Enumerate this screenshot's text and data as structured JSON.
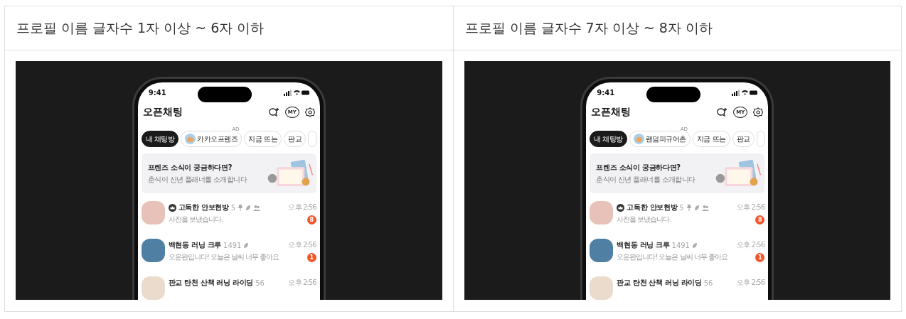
{
  "columns": [
    {
      "heading": "프로필 이름 글자수 1자 이상 ~ 6자 이하",
      "phone": {
        "status_time": "9:41",
        "app_title": "오픈채팅",
        "my_icon_label": "MY",
        "chips": [
          {
            "label": "내 채팅방",
            "selected": true,
            "kind": "plain"
          },
          {
            "label": "카카오프렌즈",
            "selected": false,
            "kind": "ad",
            "ad_label": "AD"
          },
          {
            "label": "지금 뜨는",
            "selected": false,
            "kind": "plain"
          },
          {
            "label": "판교",
            "selected": false,
            "kind": "plain"
          }
        ],
        "banner": {
          "title": "프렌즈 소식이 궁금하다면?",
          "subtitle": "춘식이 신년 플래너를 소개합니다"
        },
        "chats": [
          {
            "name": "고독한 안보현방",
            "host": true,
            "member_count": "5",
            "pin_icon": true,
            "leaf_icon": true,
            "people_icon": true,
            "preview": "사진을 보냈습니다.",
            "time": "오후 2:56",
            "unread": "8",
            "color": "#e8c2b8"
          },
          {
            "name": "백현동 러닝 크루",
            "host": false,
            "member_count": "1491",
            "pin_icon": false,
            "leaf_icon": true,
            "people_icon": false,
            "preview": "오운완입니다! 오늘은 날씨 너무 좋아요",
            "time": "오후 2:56",
            "unread": "1",
            "color": "#4f7fa3"
          },
          {
            "name": "판교 탄천 산책 러닝 라이딩",
            "host": false,
            "member_count": "56",
            "pin_icon": false,
            "leaf_icon": false,
            "people_icon": false,
            "time": "오후 2:56",
            "color": "#eadbcc"
          }
        ]
      }
    },
    {
      "heading": "프로필 이름 글자수 7자 이상 ~ 8자 이하",
      "phone": {
        "status_time": "9:41",
        "app_title": "오픈채팅",
        "my_icon_label": "MY",
        "chips": [
          {
            "label": "내 채팅방",
            "selected": true,
            "kind": "plain"
          },
          {
            "label": "랜덤피규어촌",
            "selected": false,
            "kind": "ad",
            "ad_label": "AD"
          },
          {
            "label": "지금 뜨는",
            "selected": false,
            "kind": "plain"
          },
          {
            "label": "판교",
            "selected": false,
            "kind": "plain"
          }
        ],
        "banner": {
          "title": "프렌즈 소식이 궁금하다면?",
          "subtitle": "춘식이 신년 플래너를 소개합니다"
        },
        "chats": [
          {
            "name": "고독한 안보현방",
            "host": true,
            "member_count": "5",
            "pin_icon": true,
            "leaf_icon": true,
            "people_icon": true,
            "preview": "사진을 보냈습니다.",
            "time": "오후 2:56",
            "unread": "8",
            "color": "#e8c2b8"
          },
          {
            "name": "백현동 러닝 크루",
            "host": false,
            "member_count": "1491",
            "pin_icon": false,
            "leaf_icon": true,
            "people_icon": false,
            "preview": "오운완입니다! 오늘은 날씨 너무 좋아요",
            "time": "오후 2:56",
            "unread": "1",
            "color": "#4f7fa3"
          },
          {
            "name": "판교 탄천 산책 러닝 라이딩",
            "host": false,
            "member_count": "56",
            "pin_icon": false,
            "leaf_icon": false,
            "people_icon": false,
            "time": "오후 2:56",
            "color": "#eadbcc"
          }
        ]
      }
    }
  ]
}
